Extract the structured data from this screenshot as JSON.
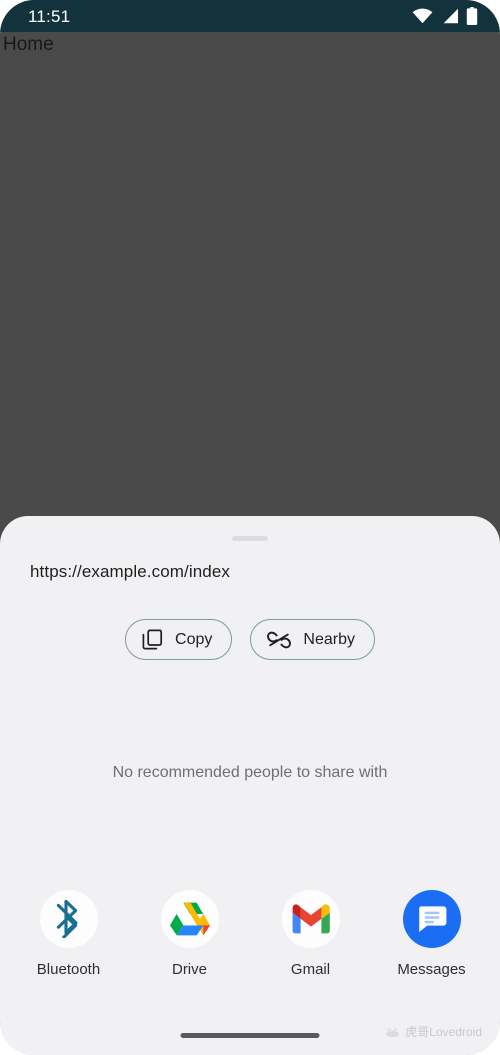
{
  "status_bar": {
    "clock": "11:51",
    "icons": [
      {
        "name": "wifi-icon",
        "label": "Wi-Fi"
      },
      {
        "name": "cellular-signal-icon",
        "label": "Cellular signal"
      },
      {
        "name": "battery-icon",
        "label": "Battery"
      }
    ],
    "background_color": "#12333b",
    "foreground_color": "#ffffff"
  },
  "background_app": {
    "label": "Home",
    "scrim_color": "#4a4a4a"
  },
  "share_sheet": {
    "background_color": "#f1f1f4",
    "drag_handle_color": "#dadce0",
    "url": "https://example.com/index",
    "actions": [
      {
        "id": "copy",
        "label": "Copy",
        "icon": "copy-icon"
      },
      {
        "id": "nearby",
        "label": "Nearby",
        "icon": "nearby-share-icon"
      }
    ],
    "chip_border_color": "#7d9aa0",
    "empty_state": "No recommended people to share with",
    "empty_state_color": "#6d7073",
    "app_targets": [
      {
        "id": "bluetooth",
        "label": "Bluetooth",
        "icon": "bluetooth-icon",
        "bg": "#fdfdfd",
        "accent": "#1a6e8e"
      },
      {
        "id": "drive",
        "label": "Drive",
        "icon": "google-drive-icon",
        "bg": "#fdfdfd",
        "accent": "#1da462"
      },
      {
        "id": "gmail",
        "label": "Gmail",
        "icon": "gmail-icon",
        "bg": "#fdfdfd",
        "accent": "#ea4335"
      },
      {
        "id": "messages",
        "label": "Messages",
        "icon": "google-messages-icon",
        "bg": "#1b6ef3",
        "accent": "#ffffff"
      }
    ]
  },
  "watermark": {
    "text": "虎哥Lovedroid",
    "icon": "watermark-logo-icon"
  },
  "navigation": {
    "home_indicator": "home-indicator-bar",
    "color": "#575b5e"
  }
}
